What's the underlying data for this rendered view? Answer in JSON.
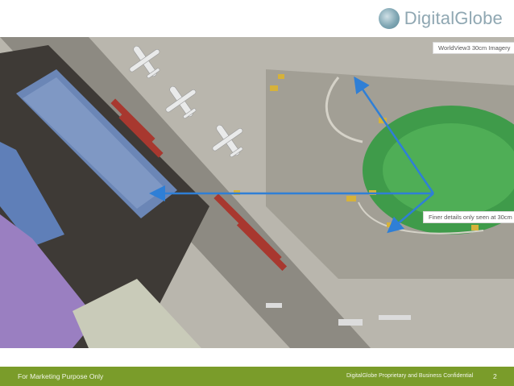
{
  "logo": {
    "text": "DigitalGlobe"
  },
  "image": {
    "caption_top": "WorldView3 30cm Imagery",
    "caption_right": "Finer details only seen at 30cm",
    "arrow_color": "#2f7fd6"
  },
  "footer": {
    "left": "For Marketing Purpose Only",
    "center": "DigitalGlobe Proprietary and Business Confidential",
    "page_number": "2",
    "color": "#7a9c2a"
  }
}
